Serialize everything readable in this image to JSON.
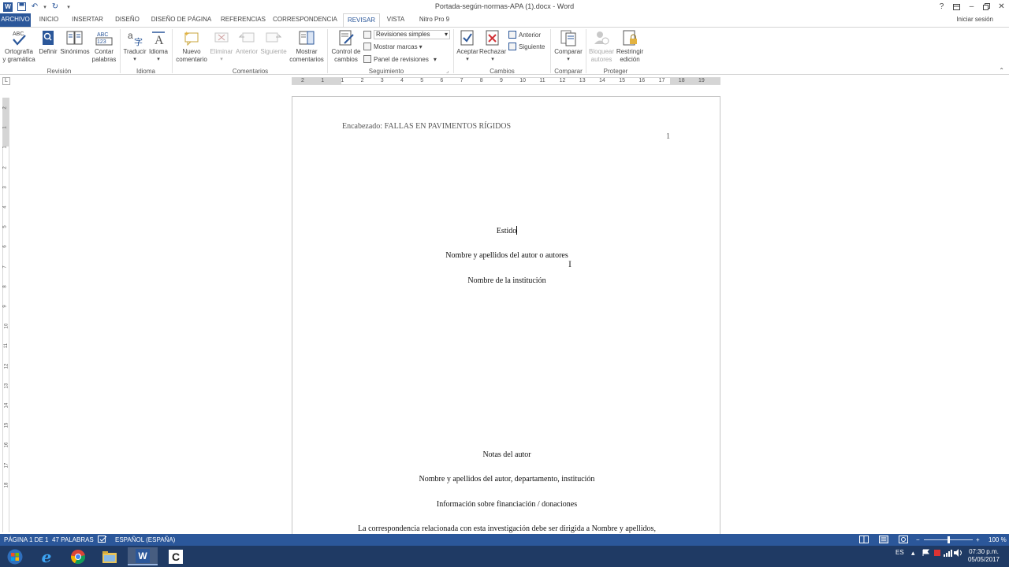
{
  "window": {
    "title": "Portada-según-normas-APA (1).docx - Word",
    "help": "?",
    "sign_in": "Iniciar sesión"
  },
  "tabs": [
    {
      "label": "ARCHIVO"
    },
    {
      "label": "INICIO"
    },
    {
      "label": "INSERTAR"
    },
    {
      "label": "DISEÑO"
    },
    {
      "label": "DISEÑO DE PÁGINA"
    },
    {
      "label": "REFERENCIAS"
    },
    {
      "label": "CORRESPONDENCIA"
    },
    {
      "label": "REVISAR"
    },
    {
      "label": "VISTA"
    },
    {
      "label": "Nitro Pro 9"
    }
  ],
  "ribbon": {
    "groups": {
      "revision": "Revisión",
      "idioma": "Idioma",
      "comentarios": "Comentarios",
      "seguimiento": "Seguimiento",
      "cambios": "Cambios",
      "comparar": "Comparar",
      "proteger": "Proteger"
    },
    "buttons": {
      "spelling_line1": "Ortografía",
      "spelling_line2": "y gramática",
      "abc": "ABC",
      "abc123": "ABC 123",
      "define": "Definir",
      "synonyms": "Sinónimos",
      "count_line1": "Contar",
      "count_line2": "palabras",
      "translate": "Traducir",
      "language": "Idioma",
      "new_comment_line1": "Nuevo",
      "new_comment_line2": "comentario",
      "delete": "Eliminar",
      "previous": "Anterior",
      "next": "Siguiente",
      "show_comments_line1": "Mostrar",
      "show_comments_line2": "comentarios",
      "track_line1": "Control de",
      "track_line2": "cambios",
      "revisions_combo": "Revisiones simples",
      "show_markup": "Mostrar marcas",
      "reviewing_pane": "Panel de revisiones",
      "accept": "Aceptar",
      "reject": "Rechazar",
      "change_previous": "Anterior",
      "change_next": "Siguiente",
      "compare": "Comparar",
      "block_line1": "Bloquear",
      "block_line2": "autores",
      "restrict_line1": "Restringir",
      "restrict_line2": "edición"
    }
  },
  "ruler": {
    "corner": "L",
    "h_numbers": [
      "2",
      "1",
      "1",
      "2",
      "3",
      "4",
      "5",
      "6",
      "7",
      "8",
      "9",
      "10",
      "11",
      "12",
      "13",
      "14",
      "15",
      "16",
      "17",
      "18",
      "19"
    ],
    "v_numbers": [
      "2",
      "1",
      "1",
      "2",
      "3",
      "4",
      "5",
      "6",
      "7",
      "8",
      "9",
      "10",
      "11",
      "12",
      "13",
      "14",
      "15",
      "16",
      "17",
      "18"
    ]
  },
  "document": {
    "header": "Encabezado: FALLAS EN PAVIMENTOS RÍGIDOS",
    "page_number": "1",
    "title": "Estido",
    "authors": "Nombre y apellidos del autor o autores",
    "institution": "Nombre de la institución",
    "author_notes": "Notas del autor",
    "author_dept": "Nombre y apellidos del autor, departamento, institución",
    "funding": "Información sobre financiación / donaciones",
    "correspondence": "La correspondencia relacionada con esta investigación debe ser dirigida a Nombre y apellidos,"
  },
  "status": {
    "page": "PÁGINA 1 DE 1",
    "words": "47 PALABRAS",
    "language": "ESPAÑOL (ESPAÑA)",
    "zoom_minus": "−",
    "zoom_plus": "+",
    "zoom": "100 %",
    "zoom_level": 0.5
  },
  "taskbar": {
    "lang": "ES",
    "time": "07:30 p.m.",
    "date": "05/05/2017"
  },
  "colors": {
    "accent": "#2b579a",
    "taskbar": "#1f3a64"
  }
}
